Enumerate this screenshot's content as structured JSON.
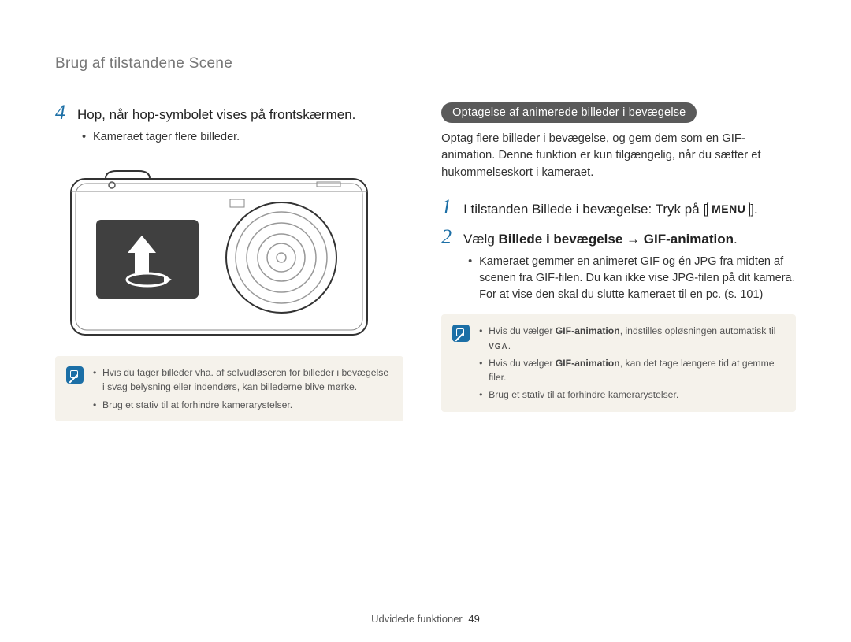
{
  "section_title": "Brug af tilstandene Scene",
  "left": {
    "step4_num": "4",
    "step4_text": "Hop, når hop-symbolet vises på frontskærmen.",
    "sub1": "Kameraet tager flere billeder.",
    "note1": "Hvis du tager billeder vha. af selvudløseren for billeder i bevægelse i svag belysning eller indendørs, kan billederne blive mørke.",
    "note2": "Brug et stativ til at forhindre kamerarystelser."
  },
  "right": {
    "pill": "Optagelse af animerede billeder i bevægelse",
    "intro": "Optag flere billeder i bevægelse, og gem dem som en GIF-animation. Denne funktion er kun tilgængelig, når du sætter et hukommelseskort i kameraet.",
    "step1_num": "1",
    "step1_pre": "I tilstanden Billede i bevægelse: Tryk på [",
    "step1_menu": "MENU",
    "step1_post": "].",
    "step2_num": "2",
    "step2_pre": "Vælg ",
    "step2_bold": "Billede i bevægelse → GIF-animation",
    "step2_post": ".",
    "sub2": "Kameraet gemmer en animeret GIF og én JPG fra midten af scenen fra GIF-filen. Du kan ikke vise JPG-filen på dit kamera. For at vise den skal du slutte kameraet til en pc. (s. 101)",
    "note1_pre": "Hvis du vælger ",
    "note1_bold": "GIF-animation",
    "note1_mid": ", indstilles opløsningen automatisk til ",
    "note1_vga": "VGA",
    "note1_post": ".",
    "note2_pre": "Hvis du vælger ",
    "note2_bold": "GIF-animation",
    "note2_post": ", kan det tage længere tid at gemme filer.",
    "note3": "Brug et stativ til at forhindre kamerarystelser."
  },
  "footer": {
    "label": "Udvidede funktioner",
    "page": "49"
  }
}
